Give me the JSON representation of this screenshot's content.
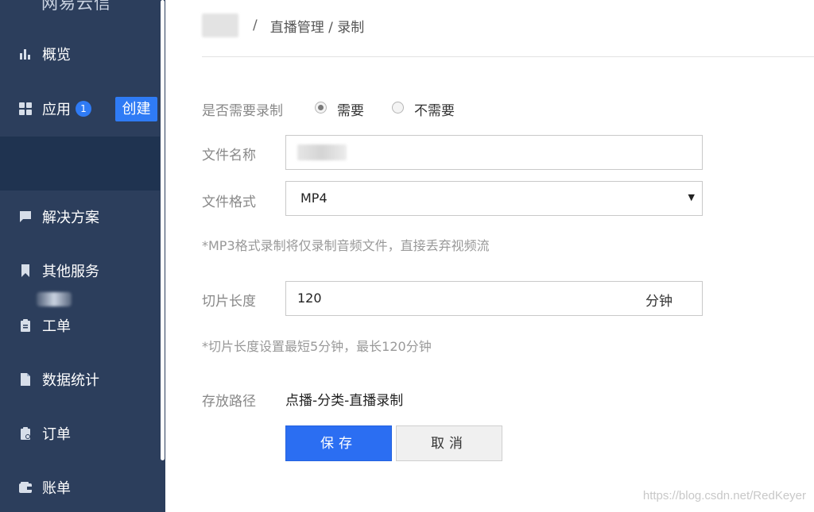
{
  "sidebar": {
    "brand": "网易云信",
    "items": [
      {
        "label": "概览",
        "icon": "bar-chart-icon"
      },
      {
        "label": "应用",
        "icon": "grid-icon",
        "badge": "1",
        "action": "创建"
      },
      {
        "label": "",
        "icon": ""
      },
      {
        "label": "解决方案",
        "icon": "chat-icon"
      },
      {
        "label": "其他服务",
        "icon": "bookmark-icon"
      },
      {
        "label": "工单",
        "icon": "clipboard-icon"
      },
      {
        "label": "数据统计",
        "icon": "document-icon"
      },
      {
        "label": "订单",
        "icon": "order-icon"
      },
      {
        "label": "账单",
        "icon": "wallet-icon"
      }
    ]
  },
  "breadcrumb": {
    "separator": "/",
    "path": "直播管理 / 录制"
  },
  "form": {
    "record": {
      "label": "是否需要录制",
      "options": [
        "需要",
        "不需要"
      ],
      "selected": "需要"
    },
    "filename": {
      "label": "文件名称"
    },
    "format": {
      "label": "文件格式",
      "value": "MP4",
      "hint": "*MP3格式录制将仅录制音频文件，直接丢弃视频流"
    },
    "slice": {
      "label": "切片长度",
      "value": "120",
      "unit": "分钟",
      "hint": "*切片长度设置最短5分钟，最长120分钟"
    },
    "storage": {
      "label": "存放路径",
      "value": "点播-分类-直播录制"
    }
  },
  "buttons": {
    "save": "保存",
    "cancel": "取消"
  },
  "watermark": "https://blog.csdn.net/RedKeyer",
  "colors": {
    "sidebar_bg": "#2c3e5c",
    "sidebar_active": "#1f3350",
    "primary": "#2b6ef2"
  }
}
